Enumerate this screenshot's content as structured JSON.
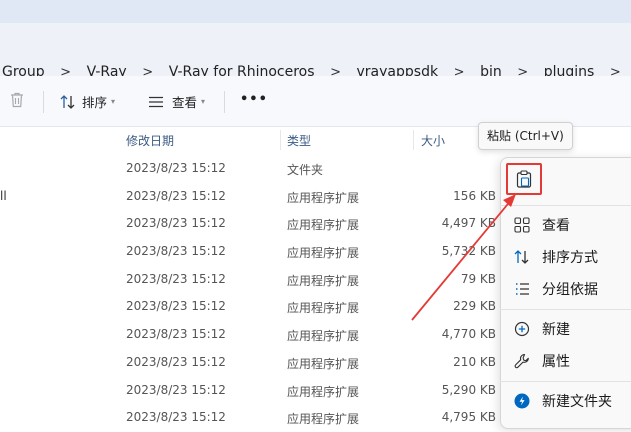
{
  "breadcrumb": [
    "Group",
    "V-Ray",
    "V-Ray for Rhinoceros",
    "vrayappsdk",
    "bin",
    "plugins"
  ],
  "toolbar": {
    "sort_label": "排序",
    "view_label": "查看",
    "more_label": "•••"
  },
  "columns": {
    "date": "修改日期",
    "type": "类型",
    "size": "大小"
  },
  "rows": [
    {
      "name": "",
      "date": "2023/8/23 15:12",
      "type": "文件夹",
      "size": ""
    },
    {
      "name": "ll",
      "date": "2023/8/23 15:12",
      "type": "应用程序扩展",
      "size": "156 KB"
    },
    {
      "name": "",
      "date": "2023/8/23 15:12",
      "type": "应用程序扩展",
      "size": "4,497 KB"
    },
    {
      "name": "",
      "date": "2023/8/23 15:12",
      "type": "应用程序扩展",
      "size": "5,732 KB"
    },
    {
      "name": "",
      "date": "2023/8/23 15:12",
      "type": "应用程序扩展",
      "size": "79 KB"
    },
    {
      "name": "",
      "date": "2023/8/23 15:12",
      "type": "应用程序扩展",
      "size": "229 KB"
    },
    {
      "name": "",
      "date": "2023/8/23 15:12",
      "type": "应用程序扩展",
      "size": "4,770 KB"
    },
    {
      "name": "",
      "date": "2023/8/23 15:12",
      "type": "应用程序扩展",
      "size": "210 KB"
    },
    {
      "name": "",
      "date": "2023/8/23 15:12",
      "type": "应用程序扩展",
      "size": "5,290 KB"
    },
    {
      "name": "",
      "date": "2023/8/23 15:12",
      "type": "应用程序扩展",
      "size": "4,795 KB"
    }
  ],
  "tooltip": "粘贴 (Ctrl+V)",
  "context_menu": {
    "view": "查看",
    "sort_by": "排序方式",
    "group_by": "分组依据",
    "new": "新建",
    "properties": "属性",
    "new_folder": "新建文件夹"
  },
  "colors": {
    "accent": "#0067c0",
    "highlight": "#e53935",
    "header_text": "#3c5b86"
  }
}
